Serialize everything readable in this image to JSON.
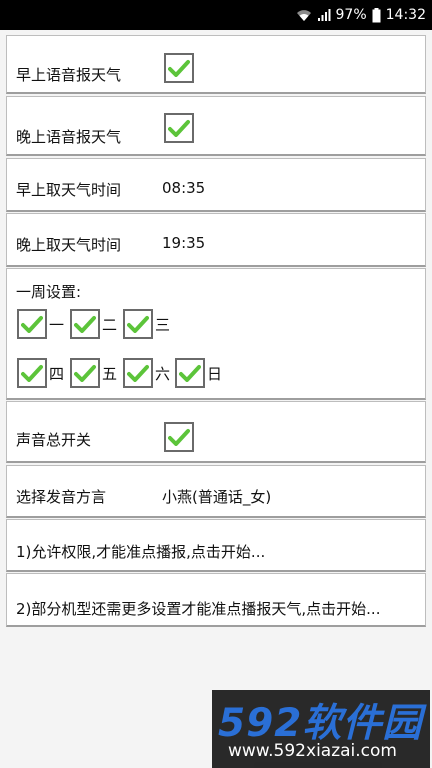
{
  "status_bar": {
    "battery": "97%",
    "time": "14:32"
  },
  "settings": {
    "morning_voice": {
      "label": "早上语音报天气",
      "checked": true
    },
    "evening_voice": {
      "label": "晚上语音报天气",
      "checked": true
    },
    "morning_time": {
      "label": "早上取天气时间",
      "value": "08:35"
    },
    "evening_time": {
      "label": "晚上取天气时间",
      "value": "19:35"
    },
    "week": {
      "label": "一周设置:",
      "days": [
        {
          "label": "一",
          "checked": true
        },
        {
          "label": "二",
          "checked": true
        },
        {
          "label": "三",
          "checked": true
        },
        {
          "label": "四",
          "checked": true
        },
        {
          "label": "五",
          "checked": true
        },
        {
          "label": "六",
          "checked": true
        },
        {
          "label": "日",
          "checked": true
        }
      ]
    },
    "master_sound": {
      "label": "声音总开关",
      "checked": true
    },
    "dialect": {
      "label": "选择发音方言",
      "value": "小燕(普通话_女)"
    },
    "permission_link": "1)允许权限,才能准点播报,点击开始...",
    "more_settings_link": "2)部分机型还需更多设置才能准点播报天气,点击开始..."
  },
  "watermark": {
    "brand": "592软件园",
    "url": "www.592xiazai.com"
  },
  "colors": {
    "check_green": "#5cc43a",
    "status_bar": "#000000",
    "watermark_blue": "#2a6fd6"
  }
}
